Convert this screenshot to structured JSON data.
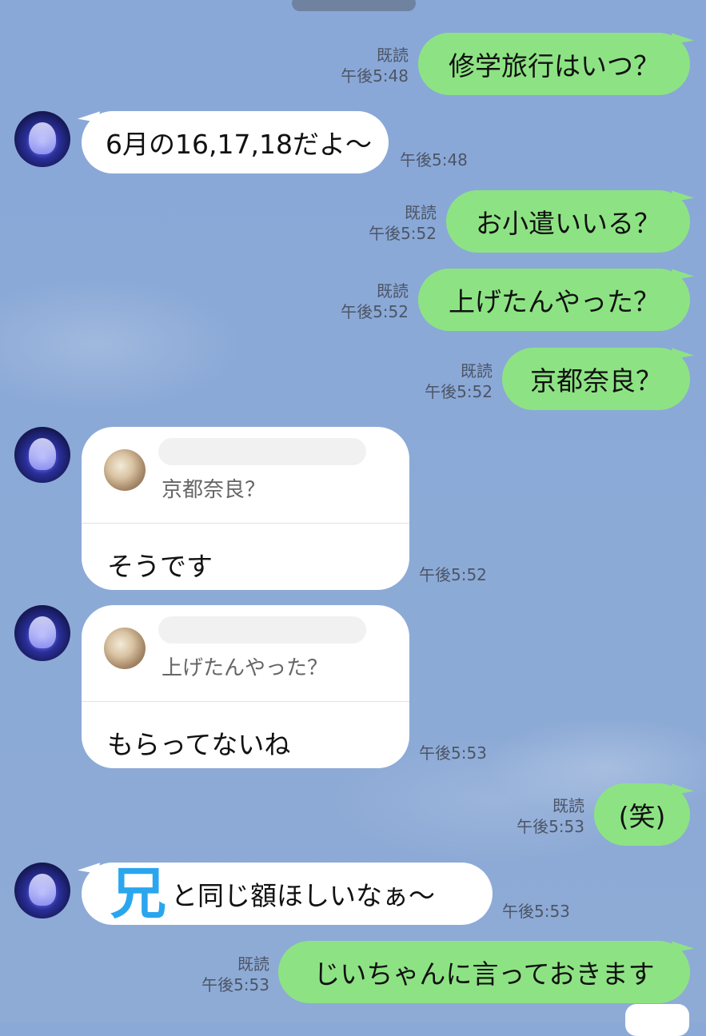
{
  "handle": "",
  "messages": [
    {
      "dir": "out",
      "text": "修学旅行はいつ？",
      "read": "既読",
      "time": "午後5:48"
    },
    {
      "dir": "in",
      "text": "6月の16,17,18だよ〜",
      "time": "午後5:48"
    },
    {
      "dir": "out",
      "text": "お小遣いいる？",
      "read": "既読",
      "time": "午後5:52"
    },
    {
      "dir": "out",
      "text": "上げたんやった？",
      "read": "既読",
      "time": "午後5:52"
    },
    {
      "dir": "out",
      "text": "京都奈良？",
      "read": "既読",
      "time": "午後5:52"
    },
    {
      "dir": "in",
      "reply_to": "京都奈良？",
      "text": "そうです",
      "time": "午後5:52"
    },
    {
      "dir": "in",
      "reply_to": "上げたんやった？",
      "text": "もらってないね",
      "time": "午後5:53"
    },
    {
      "dir": "out",
      "text": "(笑)",
      "read": "既読",
      "time": "午後5:53"
    },
    {
      "dir": "in",
      "prefix": "兄",
      "text": "と同じ額ほしいなぁ〜",
      "time": "午後5:53"
    },
    {
      "dir": "out",
      "text": "じいちゃんに言っておきます",
      "read": "既読",
      "time": "午後5:53"
    }
  ],
  "colors": {
    "background": "#8ba9d6",
    "outgoing_bubble": "#8de383",
    "incoming_bubble": "#ffffff",
    "meta_text": "#4c5566"
  }
}
